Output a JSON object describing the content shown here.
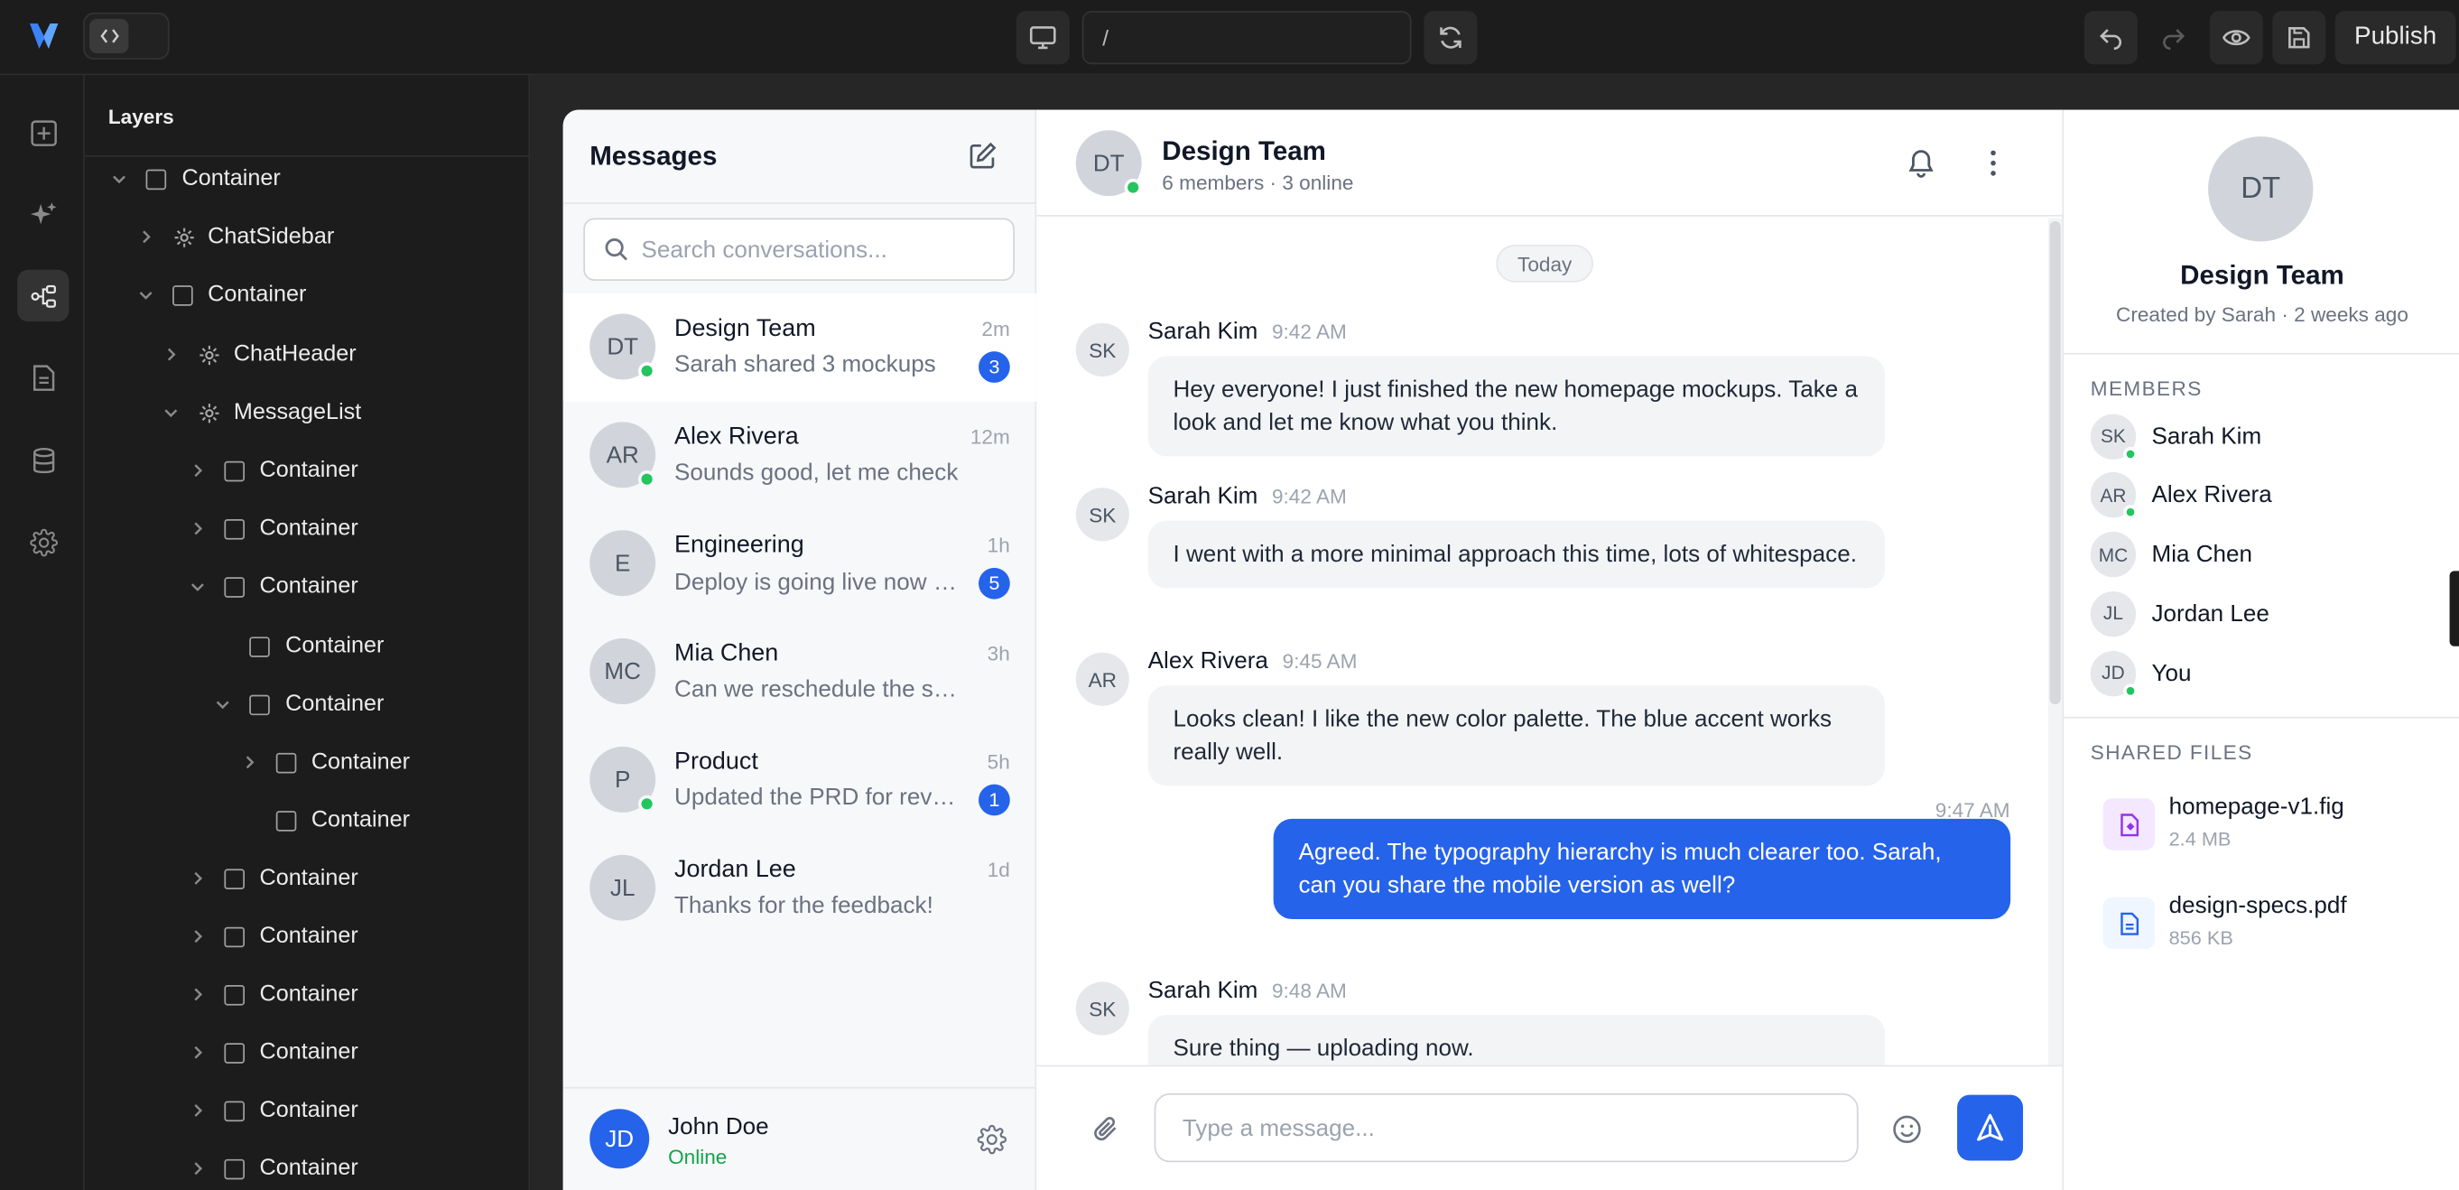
{
  "editor": {
    "url_path": "/",
    "publish_label": "Publish",
    "layers_title": "Layers",
    "tree": [
      {
        "label": "Container",
        "kind": "box",
        "depth": 0,
        "expanded": true
      },
      {
        "label": "ChatSidebar",
        "kind": "component",
        "depth": 1,
        "expanded": false
      },
      {
        "label": "Container",
        "kind": "box",
        "depth": 1,
        "expanded": true
      },
      {
        "label": "ChatHeader",
        "kind": "component",
        "depth": 2,
        "expanded": false
      },
      {
        "label": "MessageList",
        "kind": "component",
        "depth": 2,
        "expanded": true
      },
      {
        "label": "Container",
        "kind": "box",
        "depth": 3,
        "expanded": false
      },
      {
        "label": "Container",
        "kind": "box",
        "depth": 3,
        "expanded": false
      },
      {
        "label": "Container",
        "kind": "box",
        "depth": 3,
        "expanded": true
      },
      {
        "label": "Container",
        "kind": "box",
        "depth": 4,
        "expanded": null
      },
      {
        "label": "Container",
        "kind": "box",
        "depth": 4,
        "expanded": true
      },
      {
        "label": "Container",
        "kind": "box",
        "depth": 5,
        "expanded": false
      },
      {
        "label": "Container",
        "kind": "box",
        "depth": 5,
        "expanded": null
      },
      {
        "label": "Container",
        "kind": "box",
        "depth": 3,
        "expanded": false
      },
      {
        "label": "Container",
        "kind": "box",
        "depth": 3,
        "expanded": false
      },
      {
        "label": "Container",
        "kind": "box",
        "depth": 3,
        "expanded": false
      },
      {
        "label": "Container",
        "kind": "box",
        "depth": 3,
        "expanded": false
      },
      {
        "label": "Container",
        "kind": "box",
        "depth": 3,
        "expanded": false
      },
      {
        "label": "Container",
        "kind": "box",
        "depth": 3,
        "expanded": false
      }
    ]
  },
  "sidebar": {
    "title": "Messages",
    "search_placeholder": "Search conversations...",
    "conversations": [
      {
        "initials": "DT",
        "name": "Design Team",
        "preview": "Sarah shared 3 mockups",
        "time": "2m",
        "badge": "3",
        "online": true,
        "active": true
      },
      {
        "initials": "AR",
        "name": "Alex Rivera",
        "preview": "Sounds good, let me check",
        "time": "12m",
        "badge": "",
        "online": true,
        "active": false
      },
      {
        "initials": "E",
        "name": "Engineering",
        "preview": "Deploy is going live now 🚀",
        "time": "1h",
        "badge": "5",
        "online": false,
        "active": false
      },
      {
        "initials": "MC",
        "name": "Mia Chen",
        "preview": "Can we reschedule the standup?",
        "time": "3h",
        "badge": "",
        "online": false,
        "active": false
      },
      {
        "initials": "P",
        "name": "Product",
        "preview": "Updated the PRD for review",
        "time": "5h",
        "badge": "1",
        "online": true,
        "active": false
      },
      {
        "initials": "JL",
        "name": "Jordan Lee",
        "preview": "Thanks for the feedback!",
        "time": "1d",
        "badge": "",
        "online": false,
        "active": false
      }
    ],
    "user": {
      "initials": "JD",
      "name": "John Doe",
      "status": "Online"
    }
  },
  "chat": {
    "header": {
      "initials": "DT",
      "name": "Design Team",
      "subtitle": "6 members · 3 online"
    },
    "date_divider": "Today",
    "messages": [
      {
        "initials": "SK",
        "author": "Sarah Kim",
        "time": "9:42 AM",
        "text": "Hey everyone! I just finished the new homepage mockups. Take a look and let me know what you think.",
        "mine": false
      },
      {
        "initials": "SK",
        "author": "Sarah Kim",
        "time": "9:42 AM",
        "text": "I went with a more minimal approach this time, lots of whitespace.",
        "mine": false
      },
      {
        "initials": "AR",
        "author": "Alex Rivera",
        "time": "9:45 AM",
        "text": "Looks clean! I like the new color palette. The blue accent works really well.",
        "mine": false
      },
      {
        "initials": "",
        "author": "",
        "time": "9:47 AM",
        "text": "Agreed. The typography hierarchy is much clearer too. Sarah, can you share the mobile version as well?",
        "mine": true
      },
      {
        "initials": "SK",
        "author": "Sarah Kim",
        "time": "9:48 AM",
        "text": "Sure thing — uploading now.",
        "mine": false
      }
    ],
    "composer_placeholder": "Type a message..."
  },
  "info": {
    "initials": "DT",
    "name": "Design Team",
    "subtitle": "Created by Sarah · 2 weeks ago",
    "members_title": "MEMBERS",
    "members": [
      {
        "initials": "SK",
        "name": "Sarah Kim",
        "online": true
      },
      {
        "initials": "AR",
        "name": "Alex Rivera",
        "online": true
      },
      {
        "initials": "MC",
        "name": "Mia Chen",
        "online": false
      },
      {
        "initials": "JL",
        "name": "Jordan Lee",
        "online": false
      },
      {
        "initials": "JD",
        "name": "You",
        "online": true
      }
    ],
    "files_title": "SHARED FILES",
    "files": [
      {
        "name": "homepage-v1.fig",
        "size": "2.4 MB",
        "icon": "figma-file-icon"
      },
      {
        "name": "design-specs.pdf",
        "size": "856 KB",
        "icon": "document-icon"
      }
    ]
  },
  "colors": {
    "accent": "#2563eb",
    "online": "#22c55e",
    "editor_bg": "#1c1c1c"
  }
}
